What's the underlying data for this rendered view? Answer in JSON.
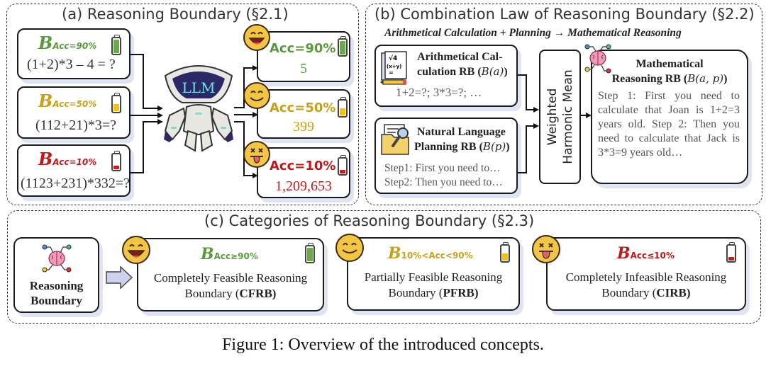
{
  "panel_a": {
    "title": "(a) Reasoning Boundary (§2.1)",
    "inputs": [
      {
        "symbol": "B",
        "subscript": "Acc=90%",
        "question": "(1+2)*3 – 4 = ?",
        "color": "#5a9a3c",
        "battery_level": 0.9
      },
      {
        "symbol": "B",
        "subscript": "Acc=50%",
        "question": "(112+21)*3=?",
        "color": "#c9a01a",
        "battery_level": 0.5
      },
      {
        "symbol": "B",
        "subscript": "Acc=10%",
        "question": "(1123+231)*332=?",
        "color": "#c01818",
        "battery_level": 0.1
      }
    ],
    "model_label": "LLM",
    "outputs": [
      {
        "acc": "Acc=90%",
        "answer": "5",
        "emoji": "laughing-face",
        "color": "#5a9a3c",
        "battery_level": 0.9
      },
      {
        "acc": "Acc=50%",
        "answer": "399",
        "emoji": "smiling-face",
        "color": "#c9a01a",
        "battery_level": 0.5
      },
      {
        "acc": "Acc=10%",
        "answer": "1,209,653",
        "emoji": "dizzy-tongue-face",
        "color": "#c01818",
        "battery_level": 0.1
      }
    ]
  },
  "panel_b": {
    "title": "(b) Combination Law of Reasoning Boundary (§2.2)",
    "subtitle": "Arithmetical Calculation + Planning → Mathematical Reasoning",
    "arith": {
      "title_line1": "Arithmetical Cal-",
      "title_line2": "culation RB (",
      "math": "B(a)",
      "close": ")",
      "body": "1+2=?; 3*3=?; …",
      "icon": "math-notes-icon"
    },
    "planning": {
      "title_line1": "Natural Language",
      "title_line2": "Planning RB (",
      "math": "B(p)",
      "close": ")",
      "body_line1": "Step1: First you need to…",
      "body_line2": "Step2: Then you need to…",
      "icon": "folder-search-icon"
    },
    "combiner": {
      "line1": "Weighted",
      "line2": "Harmonic Mean"
    },
    "math_reasoning": {
      "title_line1": "Mathematical",
      "title_line2": "Reasoning RB (",
      "math": "B(a, p)",
      "close": ")",
      "body": "Step 1: First you need to calculate that Joan is 1+2=3 years old. Step 2: Then you need to calculate that Jack is 3*3=9 years old…",
      "icon": "brain-circuit-icon"
    }
  },
  "panel_c": {
    "title": "(c) Categories of Reasoning Boundary (§2.3)",
    "source": {
      "line1": "Reasoning",
      "line2": "Boundary",
      "icon": "brain-circuit-icon"
    },
    "categories": [
      {
        "symbol": "B",
        "subscript": "Acc≥90%",
        "line1": "Completely Feasible Reasoning",
        "line2_prefix": "Boundary (",
        "abbr": "CFRB",
        "line2_suffix": ")",
        "color": "#5a9a3c",
        "emoji": "laughing-face",
        "battery_level": 0.9
      },
      {
        "symbol": "B",
        "subscript": "10%<Acc<90%",
        "line1": "Partially Feasible Reasoning",
        "line2_prefix": "Boundary (",
        "abbr": "PFRB",
        "line2_suffix": ")",
        "color": "#c9a01a",
        "emoji": "smiling-face",
        "battery_level": 0.5
      },
      {
        "symbol": "B",
        "subscript": "Acc≤10%",
        "line1": "Completely Infeasible Reasoning",
        "line2_prefix": "Boundary (",
        "abbr": "CIRB",
        "line2_suffix": ")",
        "color": "#c01818",
        "emoji": "dizzy-tongue-face",
        "battery_level": 0.1
      }
    ]
  },
  "caption": "Figure 1: Overview of the introduced concepts.",
  "colors": {
    "green": "#5a9a3c",
    "yellow": "#c9a01a",
    "red": "#c01818",
    "battery_green": "#6aaa48",
    "battery_yellow": "#f5c010",
    "battery_red": "#cc1a1a",
    "shadow": "#dfe3f2"
  }
}
